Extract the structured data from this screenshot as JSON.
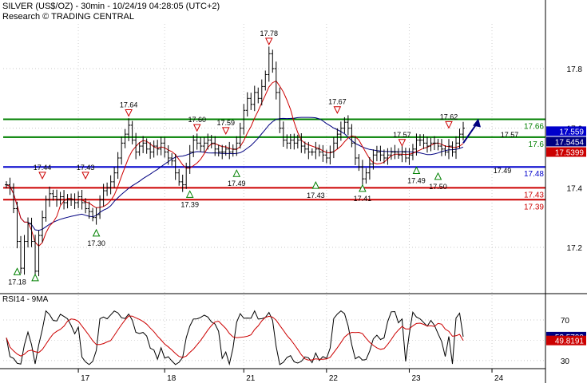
{
  "header": {
    "title": "SILVER (US$/OZ) - 30min - 10/24/19 04:28:05 (UTC+2)",
    "subtitle": "Research © TRADING CENTRAL"
  },
  "chart_data": [
    {
      "type": "line",
      "panel": "price",
      "ylim": [
        17.05,
        17.95
      ],
      "y_ticks": [
        "17.8",
        "17.6",
        "17.4",
        "17.2"
      ],
      "x_ticks": [
        "17",
        "18",
        "21",
        "22",
        "23",
        "24"
      ],
      "grid": true,
      "series": [
        {
          "kind": "bars",
          "color": "#000000",
          "values": [
            17.41,
            17.4,
            17.33,
            17.22,
            17.13,
            17.22,
            17.28,
            17.22,
            17.12,
            17.24,
            17.3,
            17.36,
            17.38,
            17.37,
            17.36,
            17.37,
            17.35,
            17.36,
            17.36,
            17.35,
            17.37,
            17.35,
            17.33,
            17.32,
            17.3,
            17.31,
            17.36,
            17.39,
            17.4,
            17.42,
            17.45,
            17.5,
            17.55,
            17.58,
            17.61,
            17.56,
            17.52,
            17.54,
            17.55,
            17.53,
            17.52,
            17.54,
            17.53,
            17.55,
            17.52,
            17.5,
            17.49,
            17.45,
            17.42,
            17.41,
            17.47,
            17.52,
            17.56,
            17.55,
            17.54,
            17.55,
            17.56,
            17.55,
            17.53,
            17.52,
            17.52,
            17.53,
            17.52,
            17.53,
            17.55,
            17.6,
            17.66,
            17.7,
            17.68,
            17.72,
            17.7,
            17.74,
            17.78,
            17.85,
            17.8,
            17.72,
            17.6,
            17.56,
            17.55,
            17.56,
            17.55,
            17.56,
            17.54,
            17.53,
            17.52,
            17.52,
            17.53,
            17.52,
            17.51,
            17.5,
            17.52,
            17.55,
            17.58,
            17.6,
            17.62,
            17.6,
            17.55,
            17.5,
            17.47,
            17.43,
            17.45,
            17.48,
            17.51,
            17.52,
            17.51,
            17.5,
            17.51,
            17.52,
            17.52,
            17.51,
            17.52,
            17.5,
            17.51,
            17.53,
            17.56,
            17.56,
            17.55,
            17.54,
            17.55,
            17.55,
            17.54,
            17.53,
            17.52,
            17.54,
            17.52,
            17.55,
            17.58,
            17.6
          ]
        },
        {
          "kind": "ma_short",
          "color": "#cc0000"
        },
        {
          "kind": "ma_long",
          "color": "#000080"
        }
      ],
      "levels": [
        {
          "value": 17.63,
          "label": "17.66",
          "color": "#008000"
        },
        {
          "value": 17.57,
          "label": "17.6",
          "color": "#008000"
        },
        {
          "value": 17.47,
          "label": "17.48",
          "color": "#0000cc"
        },
        {
          "value": 17.4,
          "label": "17.43",
          "color": "#cc0000"
        },
        {
          "value": 17.36,
          "label": "17.39",
          "color": "#cc0000"
        }
      ],
      "price_badges": [
        {
          "value": 17.59,
          "label": "17.559",
          "color": "#0000cc"
        },
        {
          "value": 17.555,
          "label": "17.5454",
          "color": "#000080"
        },
        {
          "value": 17.52,
          "label": "17.5399",
          "color": "#cc0000"
        }
      ],
      "swing_highs": [
        {
          "i": 10,
          "value": 17.42,
          "label": "17.44"
        },
        {
          "i": 22,
          "value": 17.42,
          "label": "17.43"
        },
        {
          "i": 34,
          "value": 17.63,
          "label": "17.64"
        },
        {
          "i": 53,
          "value": 17.58,
          "label": "17.60"
        },
        {
          "i": 61,
          "value": 17.57,
          "label": "17.59"
        },
        {
          "i": 73,
          "value": 17.87,
          "label": "17.78"
        },
        {
          "i": 92,
          "value": 17.64,
          "label": "17.67"
        },
        {
          "i": 110,
          "value": 17.53,
          "label": "17.57"
        },
        {
          "i": 123,
          "value": 17.59,
          "label": "17.62"
        }
      ],
      "swing_lows": [
        {
          "i": 3,
          "value": 17.14,
          "label": "17.18"
        },
        {
          "i": 8,
          "value": 17.12,
          "label": ""
        },
        {
          "i": 25,
          "value": 17.27,
          "label": "17.30"
        },
        {
          "i": 51,
          "value": 17.4,
          "label": "17.39"
        },
        {
          "i": 64,
          "value": 17.47,
          "label": "17.49"
        },
        {
          "i": 86,
          "value": 17.43,
          "label": "17.43"
        },
        {
          "i": 99,
          "value": 17.42,
          "label": "17.41"
        },
        {
          "i": 114,
          "value": 17.48,
          "label": "17.49"
        },
        {
          "i": 120,
          "value": 17.46,
          "label": "17.50"
        }
      ],
      "plain_labels": [
        {
          "i": 137,
          "value": 17.46,
          "label": "17.49"
        },
        {
          "i": 139,
          "value": 17.58,
          "label": "17.57"
        }
      ],
      "forecast_arrow": {
        "from_value": 17.55,
        "to_value": 17.63,
        "color": "#000080"
      }
    },
    {
      "type": "line",
      "panel": "indicator",
      "title": "RSI14 - 9MA",
      "ylim": [
        22,
        85
      ],
      "y_ticks": [
        "70",
        "30"
      ],
      "grid": true,
      "series": [
        {
          "kind": "rsi",
          "color": "#000000"
        },
        {
          "kind": "rsi_ma",
          "color": "#cc0000"
        }
      ],
      "badges": [
        {
          "value": 53.5799,
          "label": "53.5799",
          "color": "#000080"
        },
        {
          "value": 49.8191,
          "label": "49.8191",
          "color": "#cc0000"
        }
      ]
    }
  ]
}
